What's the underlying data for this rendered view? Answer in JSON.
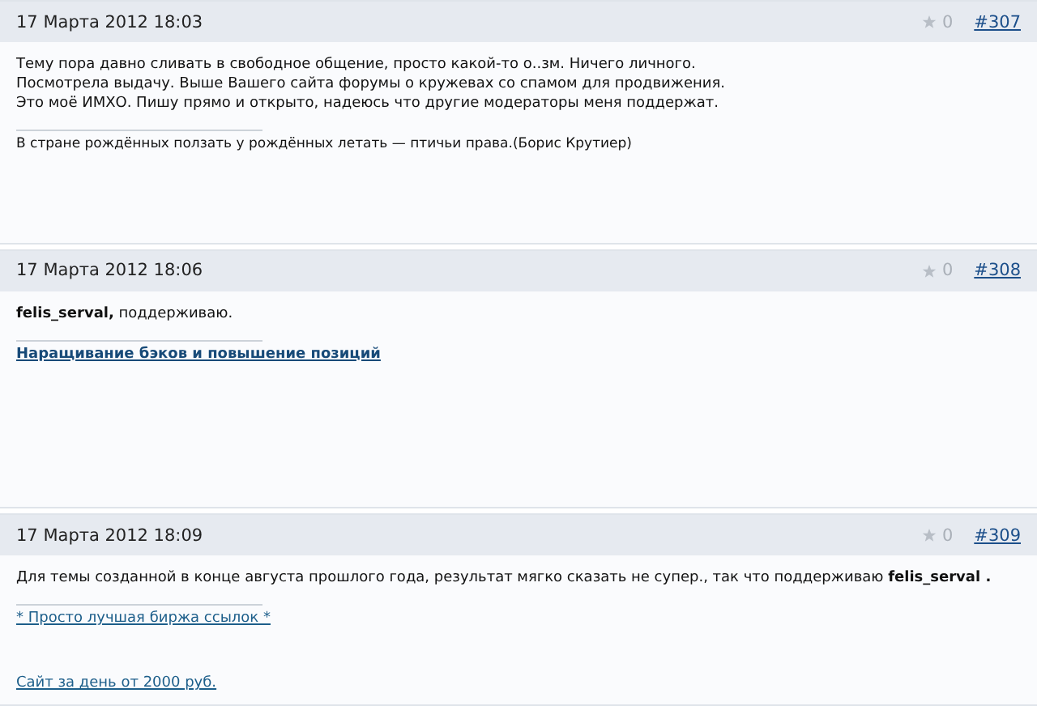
{
  "posts": [
    {
      "date": "17 Марта 2012 18:03",
      "rating": "0",
      "number": "#307",
      "body": [
        "Тему пора давно сливать в свободное общение, просто какой-то о..зм. Ничего личного.",
        "Посмотрела выдачу. Выше Вашего сайта форумы о кружевах со спамом для продвижения.",
        "Это моё ИМХО. Пишу прямо и открыто, надеюсь что другие модераторы меня поддержат."
      ],
      "signature": [
        {
          "kind": "text",
          "text": "В стране рождённых ползать у рождённых летать — птичьи права.(Борис Крутиер)"
        }
      ]
    },
    {
      "date": "17 Марта 2012 18:06",
      "rating": "0",
      "number": "#308",
      "body": [
        "**felis_serval,**  поддерживаю."
      ],
      "signature": [
        {
          "kind": "link",
          "bold": true,
          "text": "Наращивание бэков и повышение позиций"
        }
      ]
    },
    {
      "date": "17 Марта 2012 18:09",
      "rating": "0",
      "number": "#309",
      "body": [
        "Для темы созданной в конце августа прошлого года, результат мягко сказать не супер., так что поддерживаю **felis_serval .**"
      ],
      "signature": [
        {
          "kind": "link",
          "bold": false,
          "text": "* Просто лучшая биржа ссылок *"
        },
        {
          "kind": "link",
          "bold": false,
          "text": "Сайт за день от 2000 руб."
        }
      ]
    }
  ]
}
